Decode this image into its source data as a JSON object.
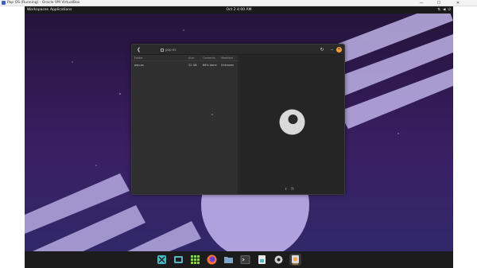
{
  "vbox": {
    "title": "Pop OS (Running) - Oracle VM VirtualBox",
    "min": "—",
    "max": "☐",
    "close": "✕"
  },
  "panel": {
    "workspaces": "Workspaces",
    "applications": "Applications",
    "clock": "Oct 2  4:00 AM",
    "status_icons": [
      "network-icon",
      "volume-icon",
      "power-icon"
    ]
  },
  "files": {
    "path_label": "pop-os",
    "columns": {
      "folder": "Folder",
      "size": "Size",
      "contents": "Contents",
      "modified": "Modified"
    },
    "rows": [
      {
        "folder": "pop-os",
        "size": "52 GB",
        "contents": "86% done",
        "modified": "Unknown"
      }
    ]
  },
  "dock": {
    "items": [
      "workspaces-icon",
      "screenshot-icon",
      "apps-grid-icon",
      "firefox-icon",
      "files-icon",
      "terminal-icon",
      "shop-icon",
      "settings-icon",
      "installer-icon"
    ]
  },
  "colors": {
    "accent": "#f6a33f",
    "wallpaper_top": "#2b1747",
    "wallpaper_bottom": "#3b2a6e"
  }
}
